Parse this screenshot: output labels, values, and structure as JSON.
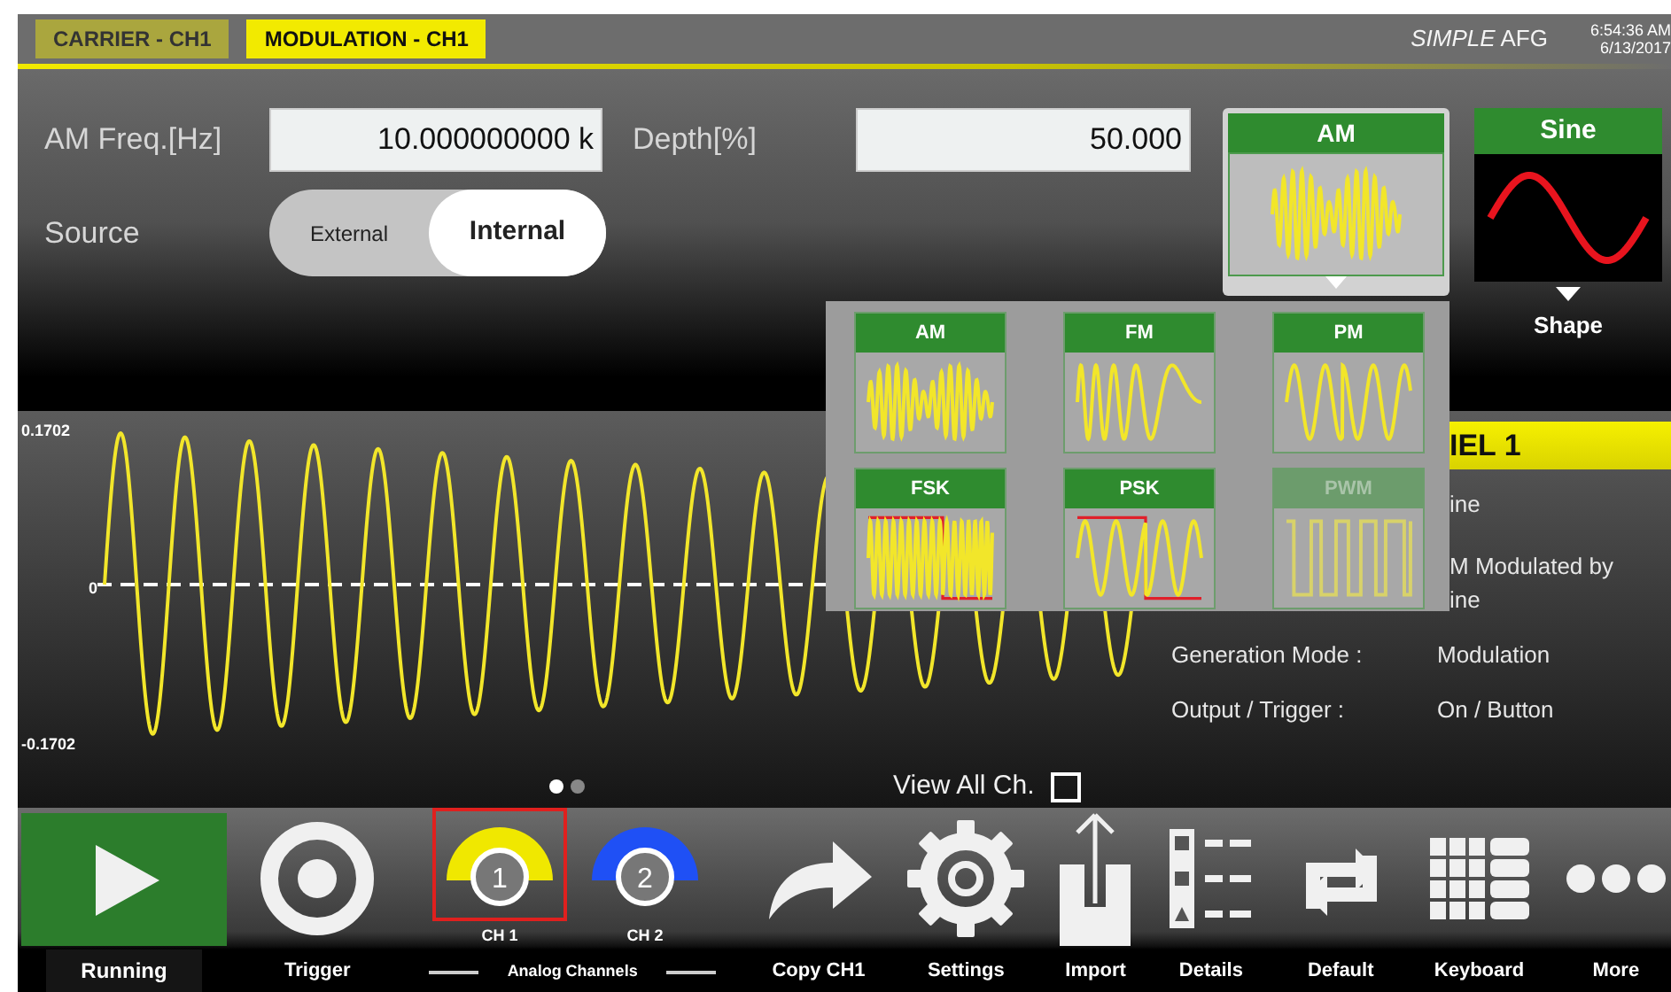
{
  "tabs": [
    {
      "label": "CARRIER - CH1",
      "selected": false
    },
    {
      "label": "MODULATION - CH1",
      "selected": true
    }
  ],
  "app_title": "*SIMPLE* AFG",
  "clock": {
    "time": "6:54:36 AM",
    "date": "6/13/2017"
  },
  "fields": [
    {
      "label": "AM Freq.[Hz]",
      "value": "10.000000000 k"
    },
    {
      "label": "Depth[%]",
      "value": "50.000"
    }
  ],
  "source": {
    "label": "Source",
    "options": [
      {
        "label": "External",
        "selected": false
      },
      {
        "label": "Internal",
        "selected": true
      }
    ]
  },
  "modulation_type": {
    "label": "AM",
    "kind": "am"
  },
  "shape": {
    "label": "Sine",
    "kind": "sine",
    "caption": "Shape"
  },
  "modulation_menu": [
    {
      "label": "AM",
      "kind": "am",
      "disabled": false
    },
    {
      "label": "FM",
      "kind": "fm",
      "disabled": false
    },
    {
      "label": "PM",
      "kind": "pm",
      "disabled": false
    },
    {
      "label": "FSK",
      "kind": "fsk",
      "disabled": false
    },
    {
      "label": "PSK",
      "kind": "psk",
      "disabled": false
    },
    {
      "label": "PWM",
      "kind": "pwm",
      "disabled": true
    }
  ],
  "plot": {
    "y_max": "0.1702",
    "y_zero": "0",
    "y_min": "-0.1702",
    "pages": [
      {
        "selected": true
      },
      {
        "selected": false
      }
    ]
  },
  "view_all": {
    "label": "View All Ch.",
    "checked": false
  },
  "channel_panel": {
    "title": "IEL 1",
    "rows": [
      {
        "value_lines": [
          "ine"
        ]
      },
      {
        "value_lines": [
          "M Modulated by",
          "ine"
        ]
      },
      {
        "label": "Generation Mode :",
        "value_lines": [
          "Modulation"
        ]
      },
      {
        "label": "Output / Trigger :",
        "value_lines": [
          "On / Button"
        ]
      }
    ]
  },
  "toolbar": [
    {
      "kind": "play",
      "label": "Running"
    },
    {
      "kind": "trigger",
      "label": "Trigger"
    },
    {
      "kind": "group",
      "label": "Analog Channels",
      "channels": [
        {
          "number": "1",
          "label": "CH 1",
          "color": "#f0e800",
          "selected": true
        },
        {
          "number": "2",
          "label": "CH 2",
          "color": "#1f50f5",
          "selected": false
        }
      ]
    },
    {
      "kind": "copy",
      "label": "Copy CH1"
    },
    {
      "kind": "settings",
      "label": "Settings"
    },
    {
      "kind": "import",
      "label": "Import"
    },
    {
      "kind": "details",
      "label": "Details"
    },
    {
      "kind": "default",
      "label": "Default"
    },
    {
      "kind": "keyboard",
      "label": "Keyboard"
    },
    {
      "kind": "more",
      "label": "More"
    }
  ]
}
